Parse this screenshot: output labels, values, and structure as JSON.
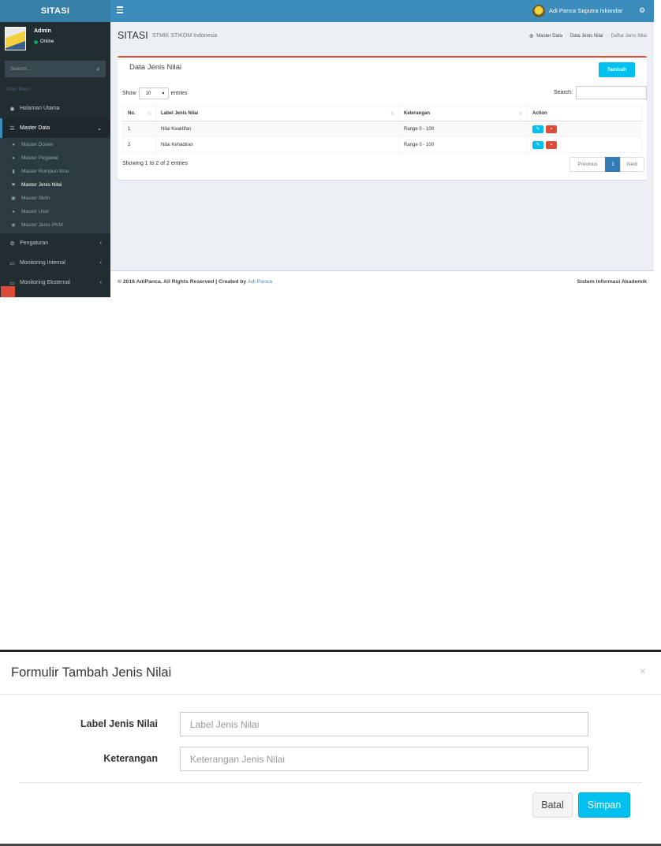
{
  "app": {
    "brand": "SITASI",
    "user_name": "Adi Panca Saputra Iskandar"
  },
  "sidebar": {
    "user": {
      "name": "Admin",
      "status": "Online"
    },
    "search_placeholder": "Search...",
    "header": "Main Menu",
    "items": [
      {
        "label": "Halaman Utama",
        "icon": "globe-icon"
      },
      {
        "label": "Master Data",
        "icon": "database-icon",
        "active": true
      },
      {
        "label": "Pengaturan",
        "icon": "cogs-icon"
      },
      {
        "label": "Monitoring Internal",
        "icon": "desktop-icon"
      },
      {
        "label": "Monitoring Eksternal",
        "icon": "desktop-icon"
      }
    ],
    "submenu": [
      {
        "label": "Master Dosen",
        "icon": "user-icon"
      },
      {
        "label": "Master Pegawai",
        "icon": "user-icon"
      },
      {
        "label": "Master Rumpun Ilmu",
        "icon": "book-icon"
      },
      {
        "label": "Master Jenis Nilai",
        "icon": "spinner-icon",
        "active": true
      },
      {
        "label": "Master Skim",
        "icon": "cubes-icon"
      },
      {
        "label": "Master User",
        "icon": "user-icon"
      },
      {
        "label": "Master Jenis PKM",
        "icon": "globe-icon"
      }
    ]
  },
  "content": {
    "title": "SITASI",
    "subtitle": "STMIK STIKOM Indonesia",
    "breadcrumb": [
      "Master Data",
      "Data Jenis Nilai",
      "Daftar Jenis Nilai"
    ]
  },
  "box": {
    "title": "Data Jenis Nilai",
    "add_button": "Tambah",
    "show_label": "Show",
    "entries_label": "entries",
    "length_value": "10",
    "search_label": "Search:",
    "columns": [
      "No.",
      "Label Jenis Nilai",
      "Keterangan",
      "Action"
    ],
    "rows": [
      {
        "no": "1",
        "label": "Nilai Keaktifan",
        "keterangan": "Range 0 - 100"
      },
      {
        "no": "2",
        "label": "Nilai Kehadiran",
        "keterangan": "Range 0 - 100"
      }
    ],
    "info": "Showing 1 to 2 of 2 entries",
    "pagination": {
      "previous": "Previous",
      "current": "1",
      "next": "Next"
    }
  },
  "footer": {
    "copyright": "© 2016 AdiPanca. All Rights Reserved | Created by ",
    "link": "Adi Panca",
    "right": "Sistem Informasi Akademik"
  },
  "modal": {
    "title": "Formulir Tambah Jenis Nilai",
    "close": "×",
    "fields": [
      {
        "label": "Label Jenis Nilai",
        "placeholder": "Label Jenis Nilai"
      },
      {
        "label": "Keterangan",
        "placeholder": "Keterangan Jenis Nilai"
      }
    ],
    "cancel_button": "Batal",
    "save_button": "Simpan"
  },
  "colors": {
    "topbar": "#3c8dbc",
    "sidebar": "#222d32",
    "box_accent": "#dd4b39",
    "info_button": "#00c0ef",
    "pager_active": "#337ab7"
  }
}
